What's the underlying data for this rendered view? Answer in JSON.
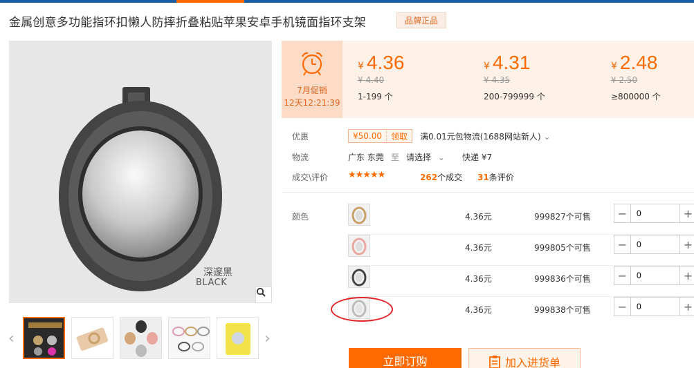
{
  "product": {
    "title": "金属创意多功能指环扣懒人防摔折叠粘贴苹果安卓手机镜面指环支架",
    "badge": "品牌正品",
    "image_caption_cn": "深邃黑",
    "image_caption_en": "BLACK"
  },
  "promo": {
    "label": "7月促销",
    "countdown": "12天12:21:39"
  },
  "price_tiers": [
    {
      "currency": "¥",
      "price": "4.36",
      "original": "¥ 4.40",
      "range": "1-199 个"
    },
    {
      "currency": "¥",
      "price": "4.31",
      "original": "¥ 4.35",
      "range": "200-799999 个"
    },
    {
      "currency": "¥",
      "price": "2.48",
      "original": "¥ 2.50",
      "range": "≥800000 个"
    }
  ],
  "offers": {
    "label": "优惠",
    "coupon_amount": "¥50.00",
    "coupon_action": "领取",
    "promo_text": "满0.01元包物流(1688网站新人)"
  },
  "logistics": {
    "label": "物流",
    "from": "广东 东莞",
    "to_word": "至",
    "select": "请选择",
    "express": "快递 ¥7"
  },
  "deals": {
    "label": "成交\\评价",
    "rating": 4.5,
    "stars": "★★★★★",
    "count": "262",
    "count_suffix": "个成交",
    "reviews": "31",
    "reviews_suffix": "条评价"
  },
  "variants": {
    "label": "颜色",
    "items": [
      {
        "color": "gold",
        "price": "4.36元",
        "stock": "999827个可售",
        "qty": "0"
      },
      {
        "color": "rose-gold",
        "price": "4.36元",
        "stock": "999805个可售",
        "qty": "0"
      },
      {
        "color": "black",
        "price": "4.36元",
        "stock": "999836个可售",
        "qty": "0"
      },
      {
        "color": "silver",
        "price": "4.36元",
        "stock": "999838个可售",
        "qty": "0"
      }
    ]
  },
  "actions": {
    "buy_now": "立即订购",
    "add_to_stock": "加入进货单"
  },
  "colors": {
    "brand_orange": "#ff6a00",
    "top_bar_blue": "#1a5ea8",
    "highlight_red": "#e2242a"
  }
}
